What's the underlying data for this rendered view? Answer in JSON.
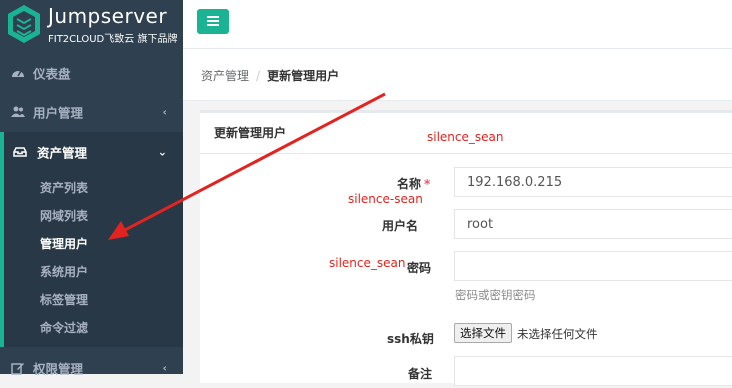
{
  "brand": {
    "title": "Jumpserver",
    "subtitle": "FIT2CLOUD飞致云 旗下品牌"
  },
  "sidebar": {
    "items": [
      {
        "label": "仪表盘",
        "icon": "dashboard-icon"
      },
      {
        "label": "用户管理",
        "icon": "users-icon",
        "chevron": "‹"
      },
      {
        "label": "资产管理",
        "icon": "inbox-icon",
        "chevron": "⌄",
        "active": true
      },
      {
        "label": "权限管理",
        "icon": "edit-icon",
        "chevron": "‹"
      }
    ],
    "subitems": [
      {
        "label": "资产列表"
      },
      {
        "label": "网域列表"
      },
      {
        "label": "管理用户",
        "active": true
      },
      {
        "label": "系统用户"
      },
      {
        "label": "标签管理"
      },
      {
        "label": "命令过滤"
      }
    ]
  },
  "breadcrumb": {
    "parent": "资产管理",
    "separator": "/",
    "current": "更新管理用户"
  },
  "panel": {
    "title": "更新管理用户"
  },
  "form": {
    "name": {
      "label": "名称",
      "required_mark": "*",
      "value": "192.168.0.215"
    },
    "username": {
      "label": "用户名",
      "value": "root"
    },
    "password": {
      "label": "密码",
      "value": "",
      "help": "密码或密钥密码"
    },
    "ssh_key": {
      "label": "ssh私钥",
      "button": "选择文件",
      "status": "未选择任何文件"
    },
    "comment": {
      "label": "备注",
      "value": ""
    }
  },
  "watermarks": {
    "panel_header": "silence_sean",
    "name_row": "silence-sean",
    "password_row": "silence_sean"
  },
  "colors": {
    "sidebar": "#2f4050",
    "accent": "#1ab394",
    "annotation": "#e3231f"
  }
}
